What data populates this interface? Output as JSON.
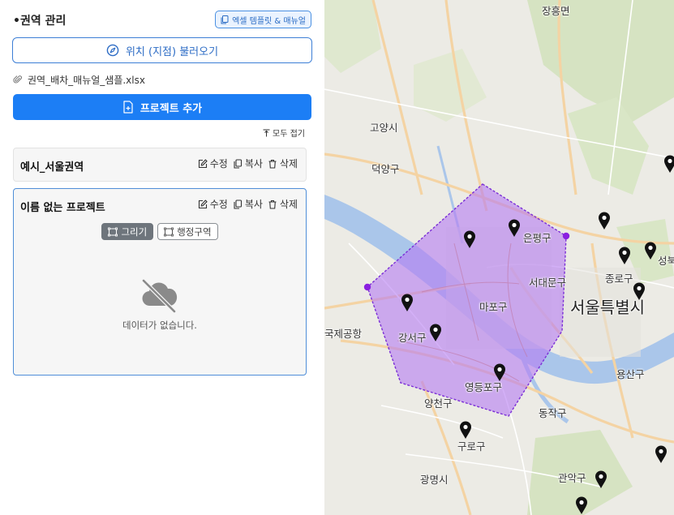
{
  "panel": {
    "title": "•권역 관리",
    "manual_button": "엑셀 템플릿 & 매뉴얼",
    "load_button": "위치 (지점) 불러오기",
    "file_name": "권역_배차_매뉴얼_샘플.xlsx",
    "add_project_button": "프로젝트 추가",
    "collapse_all": "모두 접기"
  },
  "projects": [
    {
      "name": "예시_서울권역",
      "actions": {
        "edit": "수정",
        "copy": "복사",
        "delete": "삭제"
      }
    },
    {
      "name": "이름 없는 프로젝트",
      "actions": {
        "edit": "수정",
        "copy": "복사",
        "delete": "삭제"
      },
      "modes": {
        "draw": "그리기",
        "district": "행정구역"
      },
      "empty_text": "데이터가 없습니다."
    }
  ],
  "map": {
    "labels": {
      "jangheung": "장흥면",
      "goyang": "고양시",
      "deogyang": "덕양구",
      "eunpyeong": "은평구",
      "seodaemun": "서대문구",
      "mapo": "마포구",
      "seoul": "서울특별시",
      "jongno": "종로구",
      "seongbuk": "성북",
      "airport": "국제공항",
      "gangseo": "강서구",
      "yongsan": "용산구",
      "yeongdeungpo": "영등포구",
      "yangcheon": "양천구",
      "dongjak": "동작구",
      "guro": "구로구",
      "gwanak": "관악구",
      "gwangmyeong": "광명시"
    },
    "colors": {
      "polygon_fill": "#b57cf2",
      "polygon_stroke": "#7b2fd6",
      "river": "#aac6ea",
      "park": "#d6e3c2",
      "road": "#f4d3a3"
    },
    "marker_icon": "map-pin-icon"
  },
  "colors": {
    "primary": "#1c7ef5",
    "outline_blue": "#3d7fd6",
    "mode_active": "#6e757c"
  }
}
